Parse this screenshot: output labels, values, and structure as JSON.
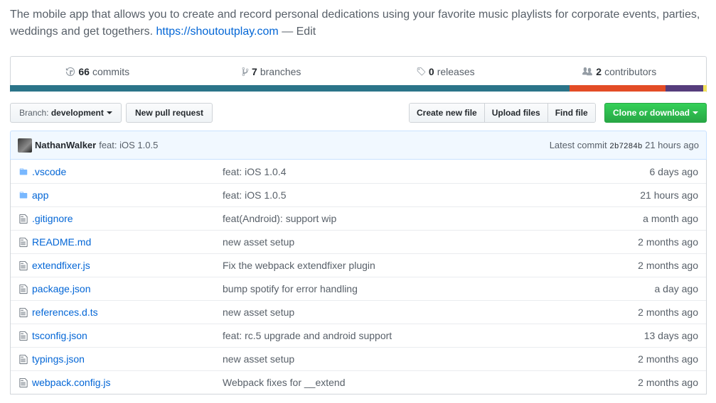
{
  "repo": {
    "description": "The mobile app that allows you to create and record personal dedications using your favorite music playlists for corporate events, parties, weddings and get togethers.",
    "homepage": "https://shoutoutplay.com",
    "edit_label": "— Edit"
  },
  "stats": {
    "commits_count": "66",
    "commits_label": "commits",
    "branches_count": "7",
    "branches_label": "branches",
    "releases_count": "0",
    "releases_label": "releases",
    "contributors_count": "2",
    "contributors_label": "contributors"
  },
  "languages": [
    {
      "share": 80.3,
      "color": "#2b7489"
    },
    {
      "share": 13.8,
      "color": "#e34c26"
    },
    {
      "share": 5.4,
      "color": "#563d7c"
    },
    {
      "share": 0.5,
      "color": "#f1e05a"
    }
  ],
  "toolbar": {
    "branch_prefix": "Branch:",
    "branch_name": "development",
    "new_pr": "New pull request",
    "create_file": "Create new file",
    "upload_files": "Upload files",
    "find_file": "Find file",
    "clone": "Clone or download"
  },
  "latest_commit": {
    "author": "NathanWalker",
    "message": "feat: iOS 1.0.5",
    "label": "Latest commit",
    "sha": "2b7284b",
    "age": "21 hours ago"
  },
  "files": [
    {
      "type": "dir",
      "icon": "folder-icon",
      "name": ".vscode",
      "message": "feat: iOS 1.0.4",
      "age": "6 days ago"
    },
    {
      "type": "dir",
      "icon": "folder-icon",
      "name": "app",
      "message": "feat: iOS 1.0.5",
      "age": "21 hours ago"
    },
    {
      "type": "file",
      "icon": "file-icon",
      "name": ".gitignore",
      "message": "feat(Android): support wip",
      "age": "a month ago"
    },
    {
      "type": "file",
      "icon": "file-icon",
      "name": "README.md",
      "message": "new asset setup",
      "age": "2 months ago"
    },
    {
      "type": "file",
      "icon": "file-icon",
      "name": "extendfixer.js",
      "message": "Fix the webpack extendfixer plugin",
      "age": "2 months ago"
    },
    {
      "type": "file",
      "icon": "file-icon",
      "name": "package.json",
      "message": "bump spotify for error handling",
      "age": "a day ago"
    },
    {
      "type": "file",
      "icon": "file-icon",
      "name": "references.d.ts",
      "message": "new asset setup",
      "age": "2 months ago"
    },
    {
      "type": "file",
      "icon": "file-icon",
      "name": "tsconfig.json",
      "message": "feat: rc.5 upgrade and android support",
      "age": "13 days ago"
    },
    {
      "type": "file",
      "icon": "file-icon",
      "name": "typings.json",
      "message": "new asset setup",
      "age": "2 months ago"
    },
    {
      "type": "file",
      "icon": "file-icon",
      "name": "webpack.config.js",
      "message": "Webpack fixes for __extend",
      "age": "2 months ago"
    }
  ]
}
